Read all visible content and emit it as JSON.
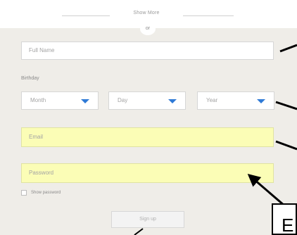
{
  "divider": {
    "text": "Show More"
  },
  "form": {
    "or_text": "or",
    "full_name_placeholder": "Full Name",
    "birthday_label": "Birthday",
    "month_label": "Month",
    "day_label": "Day",
    "year_label": "Year",
    "email_placeholder": "Email",
    "password_placeholder": "Password",
    "show_password_label": "Show password",
    "signup_label": "Sign up"
  },
  "annotation": {
    "box_text": "E"
  },
  "colors": {
    "caret": "#2f7ad6",
    "highlight": "#fbfdb6",
    "panel": "#efede8"
  }
}
